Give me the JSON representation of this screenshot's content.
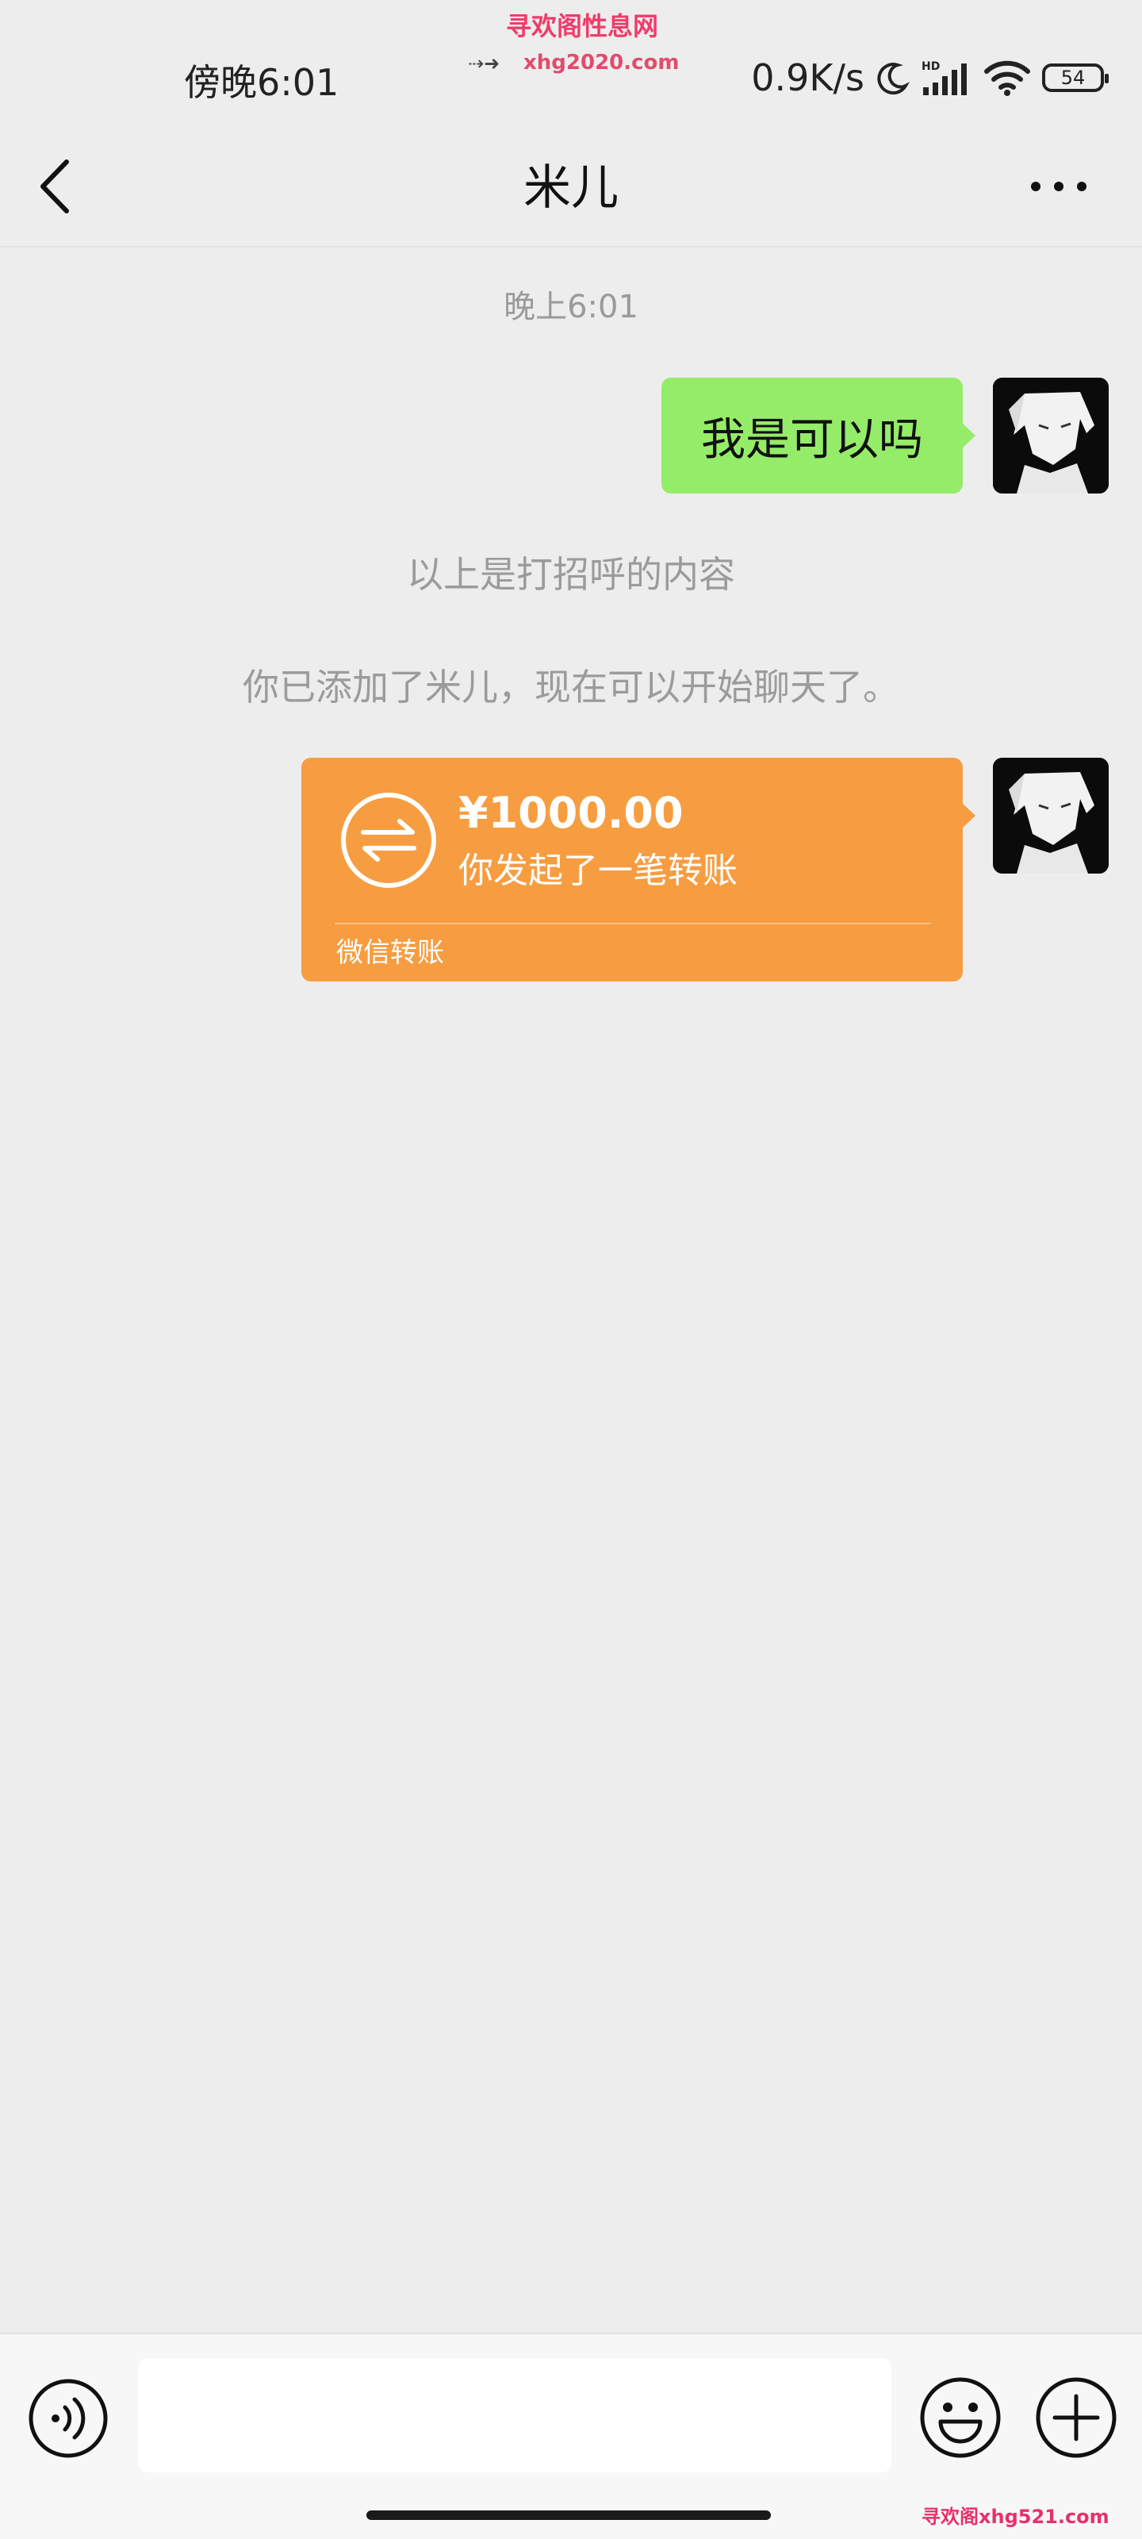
{
  "watermark": {
    "site_name": "寻欢阁性息网",
    "site_url": "xhg2020.com",
    "bottom_text": "寻欢阁xhg521.com"
  },
  "status_bar": {
    "time": "傍晚6:01",
    "network_speed": "0.9K/s",
    "battery_level": "54",
    "icons": [
      "moon-icon",
      "hd-signal-icon",
      "wifi-icon",
      "battery-icon"
    ]
  },
  "nav": {
    "title": "米儿",
    "back_icon": "chevron-left-icon",
    "more_icon": "more-dots-icon"
  },
  "chat": {
    "timestamp": "晚上6:01",
    "sent_message": "我是可以吗",
    "system_messages": [
      "以上是打招呼的内容",
      "你已添加了米儿，现在可以开始聊天了。"
    ],
    "transfer": {
      "amount": "¥1000.00",
      "description": "你发起了一笔转账",
      "label": "微信转账",
      "icon": "transfer-arrows-icon"
    }
  },
  "input_bar": {
    "text_value": "",
    "voice_icon": "voice-icon",
    "emoji_icon": "emoji-icon",
    "plus_icon": "plus-icon"
  },
  "colors": {
    "background": "#ededed",
    "sent_bubble": "#95ec69",
    "transfer_bubble": "#f79d41",
    "system_text": "#9b9b9b"
  }
}
